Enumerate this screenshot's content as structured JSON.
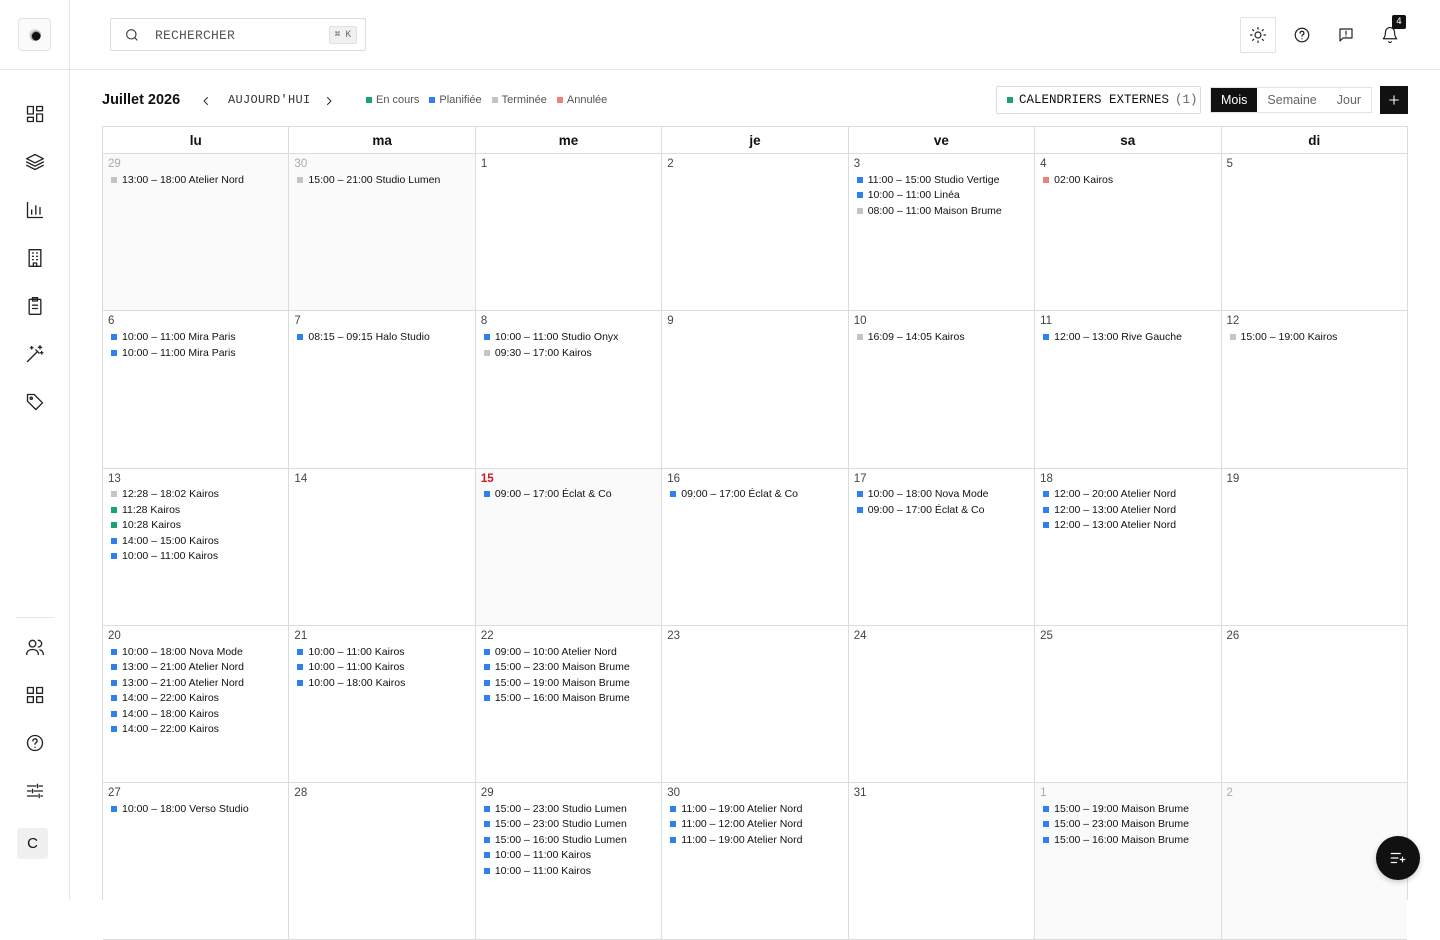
{
  "search": {
    "placeholder": "RECHERCHER",
    "shortcut": "⌘ K"
  },
  "header": {
    "notification_count": "4"
  },
  "toolbar": {
    "month_title": "Juillet 2026",
    "today_label": "AUJOURD'HUI",
    "external_calendars_label": "CALENDRIERS EXTERNES",
    "external_calendars_count": "(1)",
    "views": [
      "Mois",
      "Semaine",
      "Jour"
    ],
    "active_view": "Mois"
  },
  "legend": [
    {
      "label": "En cours",
      "color": "#1aa36f"
    },
    {
      "label": "Planifiée",
      "color": "#2f7ff0"
    },
    {
      "label": "Terminée",
      "color": "#c4c4c4"
    },
    {
      "label": "Annulée",
      "color": "#ef8080"
    }
  ],
  "status_colors": {
    "en_cours": "#1aa36f",
    "planifiee": "#2f7ff0",
    "terminee": "#c4c4c4",
    "annulee": "#ef8080"
  },
  "sidebar": {
    "avatar_initial": "C",
    "icons_top": [
      "dashboard-icon",
      "layers-icon",
      "chart-icon",
      "building-icon",
      "clipboard-icon",
      "magic-wand-icon",
      "tag-icon"
    ],
    "icons_bottom": [
      "users-icon",
      "apps-icon",
      "help-icon",
      "sliders-icon"
    ]
  },
  "calendar": {
    "weekdays": [
      "lu",
      "ma",
      "me",
      "je",
      "ve",
      "sa",
      "di"
    ],
    "weeks": [
      [
        {
          "num": "29",
          "other": true,
          "events": [
            {
              "text": "13:00 – 18:00 Atelier Nord",
              "status": "terminee"
            }
          ]
        },
        {
          "num": "30",
          "other": true,
          "events": [
            {
              "text": "15:00 – 21:00 Studio Lumen",
              "status": "terminee"
            }
          ]
        },
        {
          "num": "1",
          "events": []
        },
        {
          "num": "2",
          "events": []
        },
        {
          "num": "3",
          "events": [
            {
              "text": "11:00 – 15:00 Studio Vertige",
              "status": "planifiee"
            },
            {
              "text": "10:00 – 11:00 Linéa",
              "status": "planifiee"
            },
            {
              "text": "08:00 – 11:00 Maison Brume",
              "status": "terminee"
            }
          ]
        },
        {
          "num": "4",
          "events": [
            {
              "text": "02:00 Kairos",
              "status": "annulee"
            }
          ]
        },
        {
          "num": "5",
          "events": []
        }
      ],
      [
        {
          "num": "6",
          "events": [
            {
              "text": "10:00 – 11:00 Mira Paris",
              "status": "planifiee"
            },
            {
              "text": "10:00 – 11:00 Mira Paris",
              "status": "planifiee"
            }
          ]
        },
        {
          "num": "7",
          "events": [
            {
              "text": "08:15 – 09:15 Halo Studio",
              "status": "planifiee"
            }
          ]
        },
        {
          "num": "8",
          "events": [
            {
              "text": "10:00 – 11:00 Studio Onyx",
              "status": "planifiee"
            },
            {
              "text": "09:30 – 17:00 Kairos",
              "status": "terminee"
            }
          ]
        },
        {
          "num": "9",
          "events": []
        },
        {
          "num": "10",
          "events": [
            {
              "text": "16:09 – 14:05 Kairos",
              "status": "terminee"
            }
          ]
        },
        {
          "num": "11",
          "events": [
            {
              "text": "12:00 – 13:00 Rive Gauche",
              "status": "planifiee"
            }
          ]
        },
        {
          "num": "12",
          "events": [
            {
              "text": "15:00 – 19:00 Kairos",
              "status": "terminee"
            }
          ]
        }
      ],
      [
        {
          "num": "13",
          "events": [
            {
              "text": "12:28 – 18:02 Kairos",
              "status": "terminee"
            },
            {
              "text": "11:28 Kairos",
              "status": "en_cours"
            },
            {
              "text": "10:28 Kairos",
              "status": "en_cours"
            },
            {
              "text": "14:00 – 15:00 Kairos",
              "status": "planifiee"
            },
            {
              "text": "10:00 – 11:00 Kairos",
              "status": "planifiee"
            }
          ]
        },
        {
          "num": "14",
          "events": []
        },
        {
          "num": "15",
          "today": true,
          "events": [
            {
              "text": "09:00 – 17:00 Éclat & Co",
              "status": "planifiee"
            }
          ]
        },
        {
          "num": "16",
          "events": [
            {
              "text": "09:00 – 17:00 Éclat & Co",
              "status": "planifiee"
            }
          ]
        },
        {
          "num": "17",
          "events": [
            {
              "text": "10:00 – 18:00 Nova Mode",
              "status": "planifiee"
            },
            {
              "text": "09:00 – 17:00 Éclat & Co",
              "status": "planifiee"
            }
          ]
        },
        {
          "num": "18",
          "events": [
            {
              "text": "12:00 – 20:00 Atelier Nord",
              "status": "planifiee"
            },
            {
              "text": "12:00 – 13:00 Atelier Nord",
              "status": "planifiee"
            },
            {
              "text": "12:00 – 13:00 Atelier Nord",
              "status": "planifiee"
            }
          ]
        },
        {
          "num": "19",
          "events": []
        }
      ],
      [
        {
          "num": "20",
          "events": [
            {
              "text": "10:00 – 18:00 Nova Mode",
              "status": "planifiee"
            },
            {
              "text": "13:00 – 21:00 Atelier Nord",
              "status": "planifiee"
            },
            {
              "text": "13:00 – 21:00 Atelier Nord",
              "status": "planifiee"
            },
            {
              "text": "14:00 – 22:00 Kairos",
              "status": "planifiee"
            },
            {
              "text": "14:00 – 18:00 Kairos",
              "status": "planifiee"
            },
            {
              "text": "14:00 – 22:00 Kairos",
              "status": "planifiee"
            }
          ]
        },
        {
          "num": "21",
          "events": [
            {
              "text": "10:00 – 11:00 Kairos",
              "status": "planifiee"
            },
            {
              "text": "10:00 – 11:00 Kairos",
              "status": "planifiee"
            },
            {
              "text": "10:00 – 18:00 Kairos",
              "status": "planifiee"
            }
          ]
        },
        {
          "num": "22",
          "events": [
            {
              "text": "09:00 – 10:00 Atelier Nord",
              "status": "planifiee"
            },
            {
              "text": "15:00 – 23:00 Maison Brume",
              "status": "planifiee"
            },
            {
              "text": "15:00 – 19:00 Maison Brume",
              "status": "planifiee"
            },
            {
              "text": "15:00 – 16:00 Maison Brume",
              "status": "planifiee"
            }
          ]
        },
        {
          "num": "23",
          "events": []
        },
        {
          "num": "24",
          "events": []
        },
        {
          "num": "25",
          "events": []
        },
        {
          "num": "26",
          "events": []
        }
      ],
      [
        {
          "num": "27",
          "events": [
            {
              "text": "10:00 – 18:00 Verso Studio",
              "status": "planifiee"
            }
          ]
        },
        {
          "num": "28",
          "events": []
        },
        {
          "num": "29",
          "events": [
            {
              "text": "15:00 – 23:00 Studio Lumen",
              "status": "planifiee"
            },
            {
              "text": "15:00 – 23:00 Studio Lumen",
              "status": "planifiee"
            },
            {
              "text": "15:00 – 16:00 Studio Lumen",
              "status": "planifiee"
            },
            {
              "text": "10:00 – 11:00 Kairos",
              "status": "planifiee"
            },
            {
              "text": "10:00 – 11:00 Kairos",
              "status": "planifiee"
            }
          ]
        },
        {
          "num": "30",
          "events": [
            {
              "text": "11:00 – 19:00 Atelier Nord",
              "status": "planifiee"
            },
            {
              "text": "11:00 – 12:00 Atelier Nord",
              "status": "planifiee"
            },
            {
              "text": "11:00 – 19:00 Atelier Nord",
              "status": "planifiee"
            }
          ]
        },
        {
          "num": "31",
          "events": []
        },
        {
          "num": "1",
          "other": true,
          "events": [
            {
              "text": "15:00 – 19:00 Maison Brume",
              "status": "planifiee"
            },
            {
              "text": "15:00 – 23:00 Maison Brume",
              "status": "planifiee"
            },
            {
              "text": "15:00 – 16:00 Maison Brume",
              "status": "planifiee"
            }
          ]
        },
        {
          "num": "2",
          "other": true,
          "events": []
        }
      ]
    ]
  }
}
